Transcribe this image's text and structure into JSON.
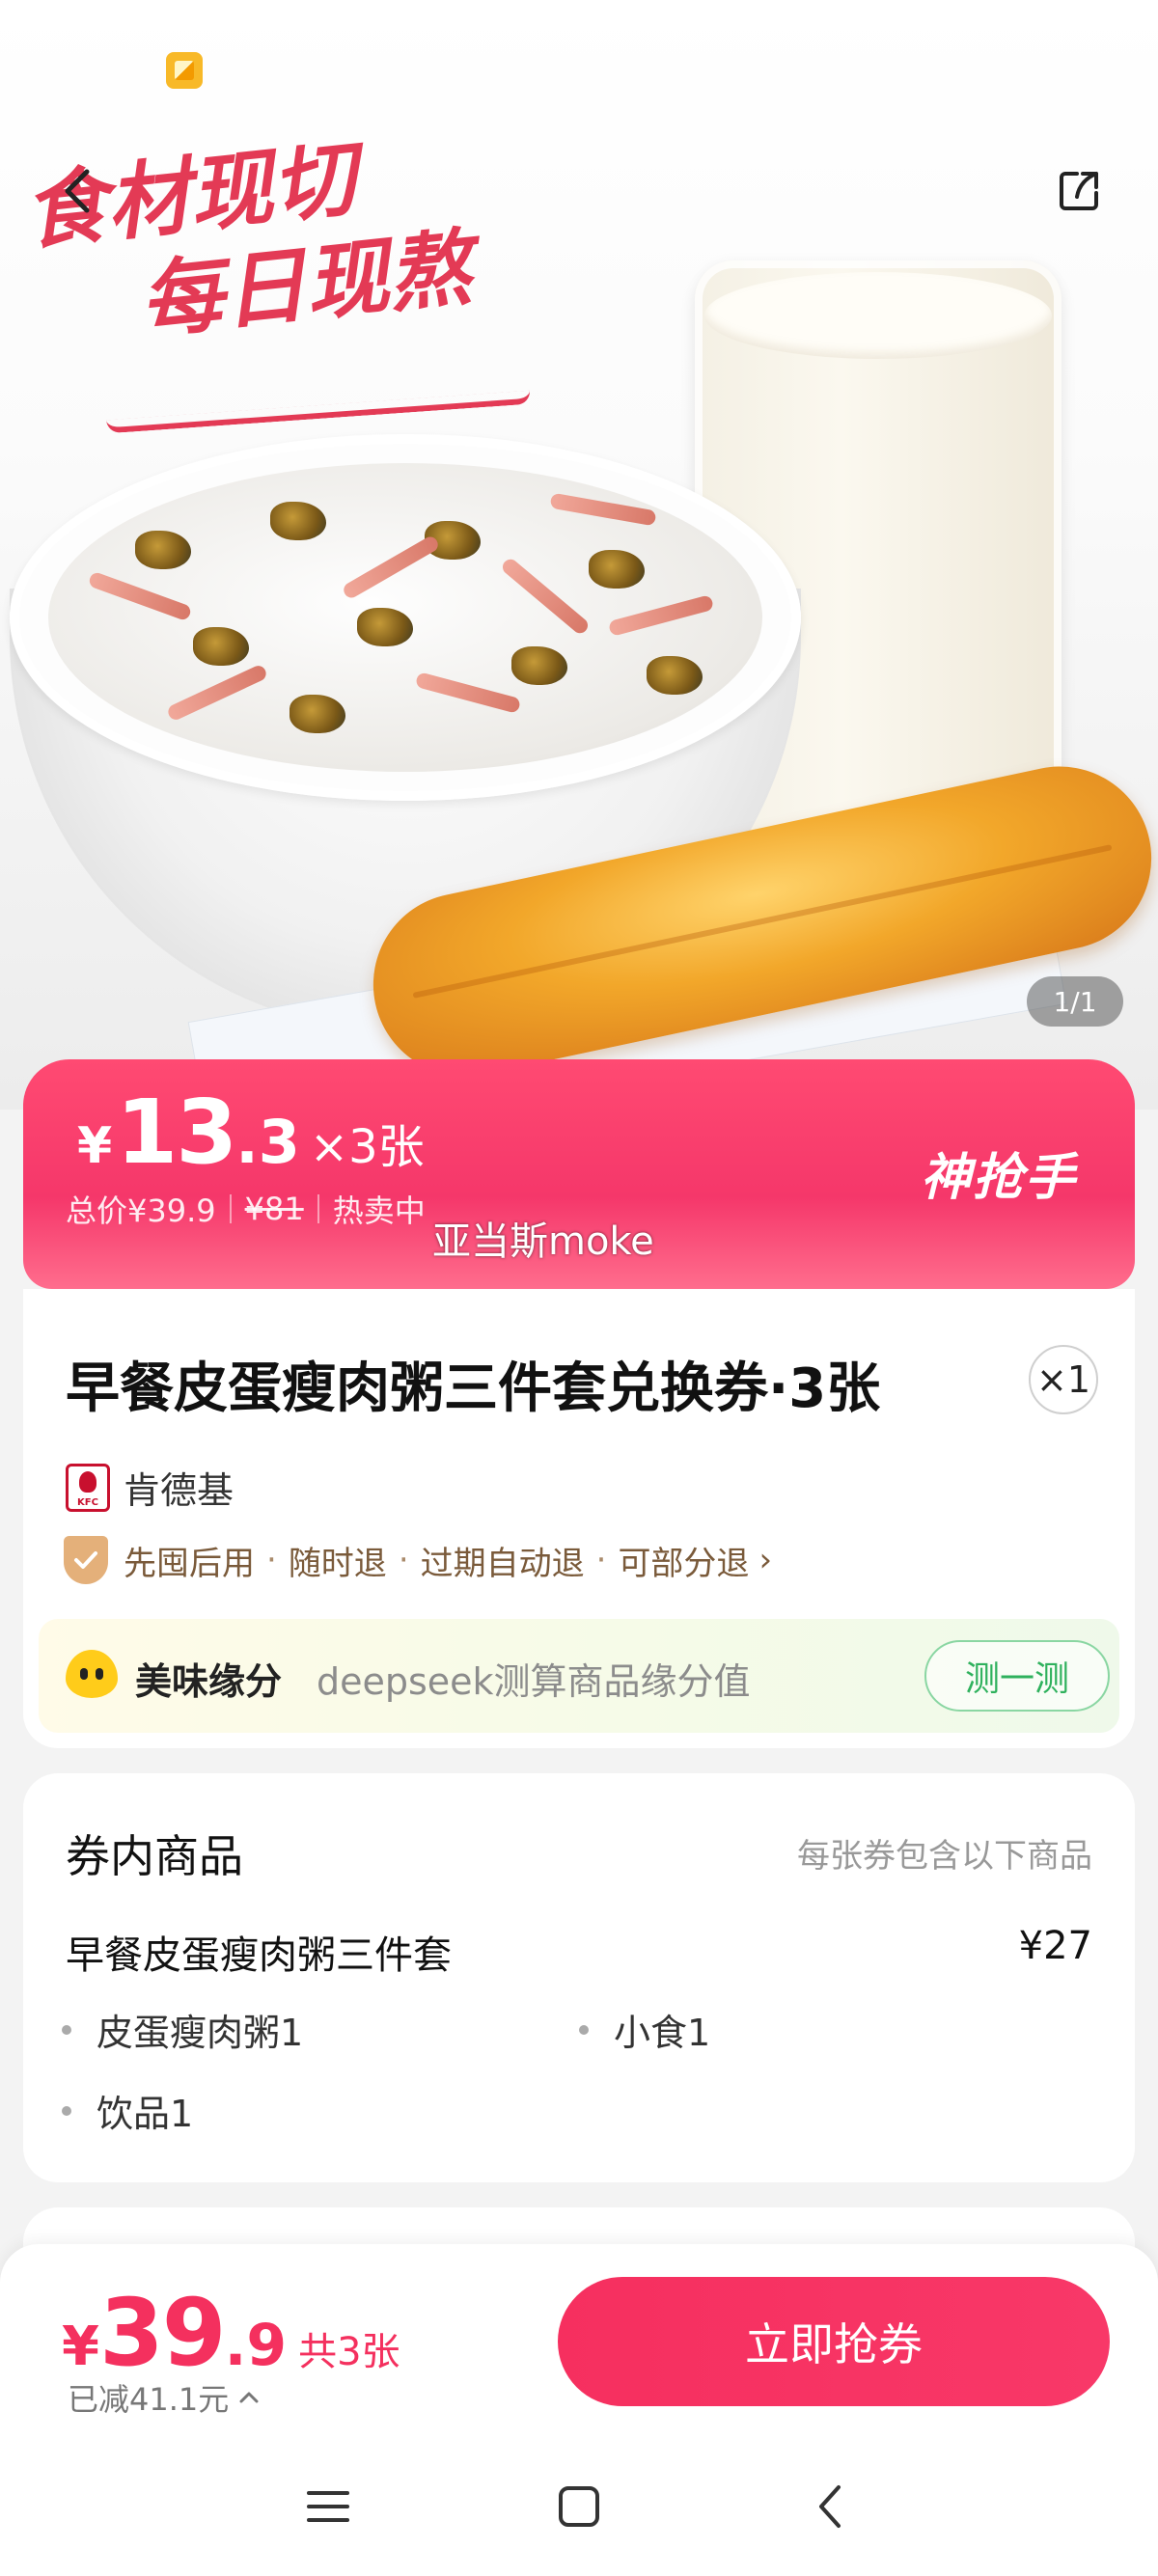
{
  "hero": {
    "slogan_line1": "食材现切",
    "slogan_line2": "每日现熬",
    "image_counter": "1/1"
  },
  "price_banner": {
    "currency": "¥",
    "price_int": "13",
    "price_dec": ".3",
    "quantity": "×3张",
    "total_label": "总价¥39.9",
    "original_price": "¥81",
    "hot_label": "热卖中",
    "badge": "神抢手"
  },
  "watermark": "亚当斯moke",
  "product": {
    "title": "早餐皮蛋瘦肉粥三件套兑换券·3张",
    "quantity_badge": "×1",
    "brand": "肯德基",
    "brand_logo_text": "KFC",
    "services": [
      "先囤后用",
      "随时退",
      "过期自动退",
      "可部分退"
    ],
    "service_sep": "·"
  },
  "fate": {
    "title": "美味缘分",
    "description": "deepseek测算商品缘分值",
    "button": "测一测"
  },
  "voucher_items": {
    "heading": "券内商品",
    "note": "每张券包含以下商品",
    "set_name": "早餐皮蛋瘦肉粥三件套",
    "set_price": "¥27",
    "items": [
      "皮蛋瘦肉粥1",
      "小食1",
      "饮品1"
    ]
  },
  "bottom_bar": {
    "currency": "¥",
    "price_int": "39",
    "price_dec": ".9",
    "count": "共3张",
    "saved": "已减41.1元",
    "buy_button": "立即抢券"
  },
  "colors": {
    "accent": "#f4305e",
    "banner": "#f5376a",
    "service_text": "#7a5a3a",
    "fate_green": "#2fb15d"
  },
  "icons": {
    "back": "chevron-left-icon",
    "share": "share-icon",
    "service": "shield-check-icon",
    "chevron": "chevron-right-icon",
    "fate": "heart-face-icon",
    "expand": "chevron-up-icon",
    "sys_menu": "menu-icon",
    "sys_home": "home-icon",
    "sys_back": "back-icon"
  }
}
